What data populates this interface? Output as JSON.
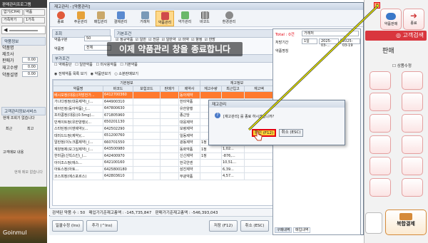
{
  "left_panel": {
    "title": "판매관리프로그램",
    "button_row1": [
      "압기(CH4)",
      "약품"
    ],
    "button_row2": [
      "가족하기",
      "1가족"
    ],
    "section_drug": "약품정보",
    "drug_labels": [
      "약품명",
      "제조사",
      "판매가",
      "재고수량",
      "약품설명"
    ],
    "value_zero": "0.00",
    "section_cust": "고객관리정보서비스",
    "cust_prompt": "현재 조회기 없습니다",
    "cust_cols": [
      "최근",
      "최고"
    ],
    "note_label": "고객메모 내용",
    "note_text": "현재 메모 없습니다",
    "watermark": "Goinmul"
  },
  "window": {
    "title": "재고관리 - [약품관리]",
    "toolbar": [
      "종료",
      "주문관리",
      "매입관리",
      "결제관리",
      "거래처",
      "약품관리",
      "약가관리",
      "바코드",
      "환경관리"
    ],
    "active_tool": "약품관리",
    "section_search": "조회",
    "search_label1": "약품구분",
    "search_value1": "50",
    "search_label2": "약품명",
    "search_value2": "전체",
    "section_basic": "기본조건",
    "checks": [
      "정규약품",
      "일반",
      "전문",
      "일반약",
      "마약",
      "향정",
      "한방"
    ],
    "section_detail": "부가조건",
    "detail_checks": [
      "약제중단",
      "일반약품",
      "미사용약품",
      "기본약품"
    ],
    "view_options": [
      "전체약품 목록 보기",
      "약품만보기",
      "소분판매보기"
    ],
    "grid_header_group": "기본정보",
    "grid_header_group2": "재고정보",
    "grid_cols": [
      "약품명",
      "바코드",
      "보험코드",
      "판매가",
      "제약사",
      "재고수량",
      "최근입고",
      "재고액"
    ],
    "rows": [
      [
        "베시모정(대웅)(처방전가...",
        "6412700360",
        "",
        "",
        "동아제약",
        "",
        "",
        ""
      ],
      [
        "가나다정정(대웅제약)_(...",
        "644900310",
        "",
        "",
        "한미약품",
        "",
        "",
        ""
      ],
      [
        "베아민정(동아약품)_(...",
        "647800630",
        "",
        "",
        "유한양행",
        "",
        "",
        ""
      ],
      [
        "프라콩정(대웅)(0.5mg)...",
        "671805960",
        "",
        "",
        "종근당",
        "",
        "",
        ""
      ],
      [
        "민케이트정(유한양행)(...",
        "650201130",
        "",
        "",
        "대웅제약",
        "",
        "",
        ""
      ],
      [
        "스타틴정(이엔제약)(...",
        "642502290",
        "",
        "",
        "보령제약",
        "",
        "",
        ""
      ],
      [
        "데미드드정(제약)(...",
        "651200760",
        "",
        "",
        "일동제약",
        "",
        "2,51...",
        ""
      ],
      [
        "알란정(이노크롬제약)_(...",
        "660701550",
        "",
        "",
        "광동제약",
        "1정",
        "2,51...",
        ""
      ],
      [
        "계양정제(모그딜제약)_(...",
        "643500980",
        "",
        "",
        "동화약품",
        "1정",
        "1,02...",
        ""
      ],
      [
        "한미글(신빅스킨)_(...",
        "642400970",
        "",
        "",
        "신신제약",
        "1정",
        "-876,...",
        ""
      ],
      [
        "아이조스정(에스...",
        "642100160",
        "",
        "",
        "한국얀센",
        "",
        "10,51...",
        ""
      ],
      [
        "아토스정(아토...",
        "6425800180",
        "",
        "",
        "삼진제약",
        "",
        "6,39...",
        ""
      ],
      [
        "코스피정(에스포르스)",
        "642803610",
        "",
        "",
        "부광약품",
        "",
        "4,57...",
        ""
      ]
    ],
    "status_count_label": "검색된 약품 수 : 50",
    "status_total_label": "매입가기준재고총액 : -145,735,847",
    "status_sale_label": "판매가기준재고총액 : -546,393,043",
    "bottom_buttons": [
      "일괄수정 (Ins)",
      "추가 (^Ins)",
      "저장 (F12)",
      "취소 (ESC)"
    ]
  },
  "sidewin": {
    "total_label": "Total : 0건",
    "field_labels": [
      "처방기간",
      "약품명칭"
    ],
    "field_values": [
      "거래처",
      "1일",
      "2025-03-...",
      "2025-03-19"
    ],
    "footer_tabs": [
      "구매내역",
      "매입내역"
    ]
  },
  "dialog": {
    "title": "재고관리",
    "message": "[재고관리] 를 종료 하시겠습니까?",
    "confirm_label": "확인 (F12)",
    "cancel_label": "취소 (ESC)"
  },
  "banner": {
    "text": "이제 약품관리 창을 종료합니다"
  },
  "right_panel": {
    "top_buttons": [
      "약품판매",
      "종료"
    ],
    "customer_button": "고객검색",
    "sales_tab": "판매",
    "status_label": "상품수정",
    "bottom_button": "복합결제"
  },
  "colors": {
    "selection": "#ff7a2e",
    "pointer_line": "#e6e600",
    "accent_red": "#e4000f"
  }
}
